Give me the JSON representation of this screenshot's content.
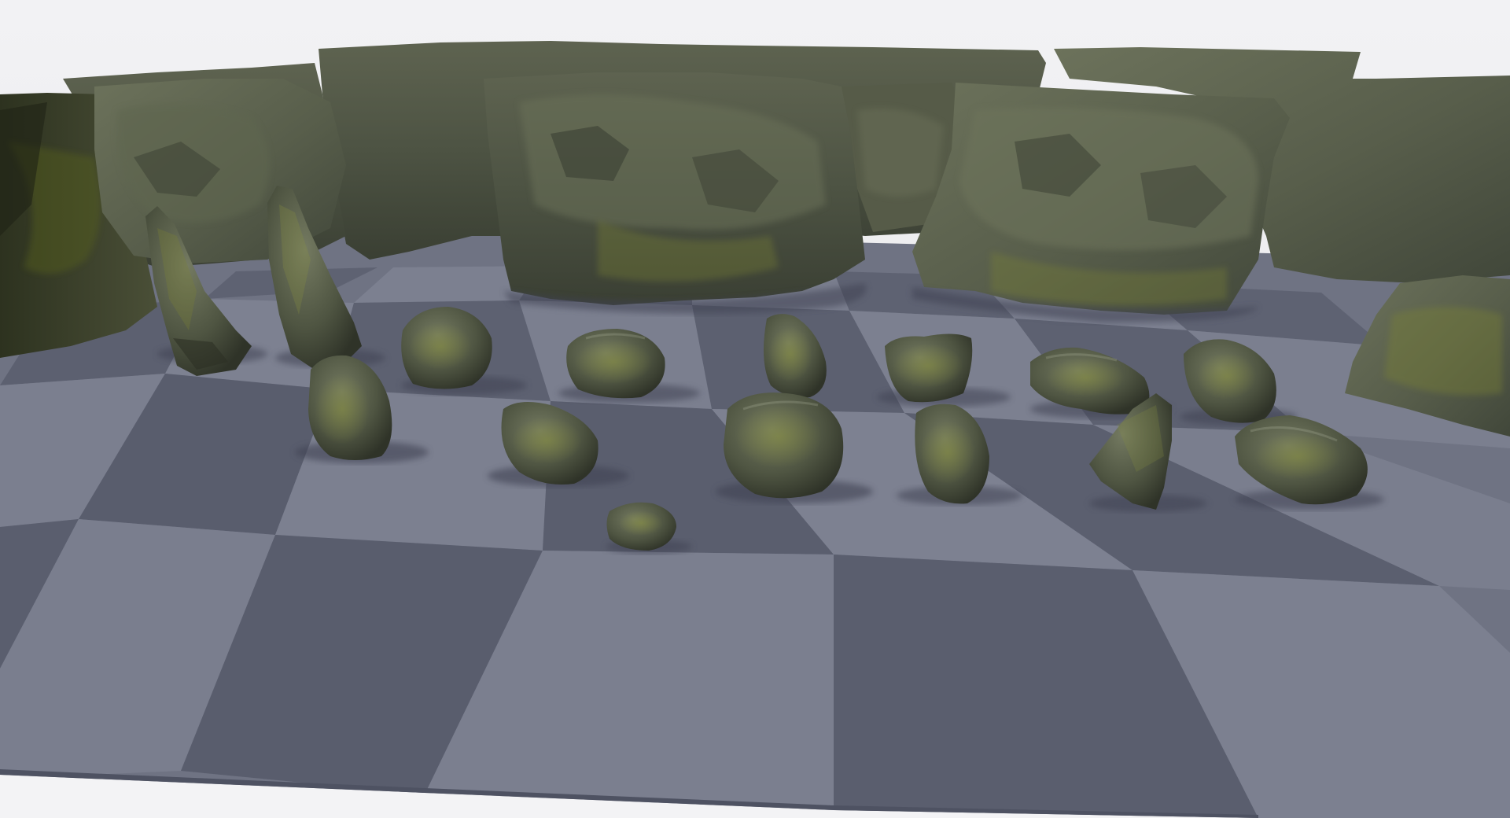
{
  "scene": {
    "type": "3d-viewport",
    "subject": "rock-asset-showcase",
    "sky_color": "#ececef",
    "floor_light_color": "#7b7f8f",
    "floor_dark_color": "#5c6070",
    "floor_edge_color": "#f3f3f5",
    "rock_base_color": "#4a5040",
    "moss_color": "#7a8236",
    "shadow_color": "#3f4352",
    "cliff_count": 11,
    "standing_stone_count": 2,
    "boulder_count": 16
  }
}
